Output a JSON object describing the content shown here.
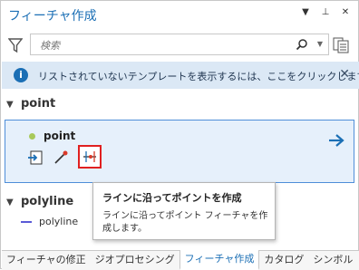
{
  "pane": {
    "title": "フィーチャ作成",
    "controls": [
      "▼",
      "⊥",
      "✕"
    ]
  },
  "search": {
    "placeholder": "検索",
    "value": ""
  },
  "info_bar": {
    "text": "リストされていないテンプレートを表示するには、ここをクリックします。"
  },
  "groups": [
    {
      "name": "point"
    },
    {
      "name": "polyline"
    }
  ],
  "point_template": {
    "name": "point",
    "point_color": "#a8c95a"
  },
  "polyline_template": {
    "name": "polyline",
    "line_color": "#5a5ad6"
  },
  "tooltip": {
    "title": "ラインに沿ってポイントを作成",
    "body": "ラインに沿ってポイント フィーチャを作成します。"
  },
  "tabs": [
    {
      "label": "フィーチャの修正",
      "active": false
    },
    {
      "label": "ジオプロセシング",
      "active": false
    },
    {
      "label": "フィーチャ作成",
      "active": true
    },
    {
      "label": "カタログ",
      "active": false
    },
    {
      "label": "シンボル",
      "active": false
    }
  ],
  "colors": {
    "accent": "#1b6fb5",
    "info_bg": "#dbe8f5",
    "selected_border": "#4f8ed9",
    "highlight_box": "#e02020"
  }
}
